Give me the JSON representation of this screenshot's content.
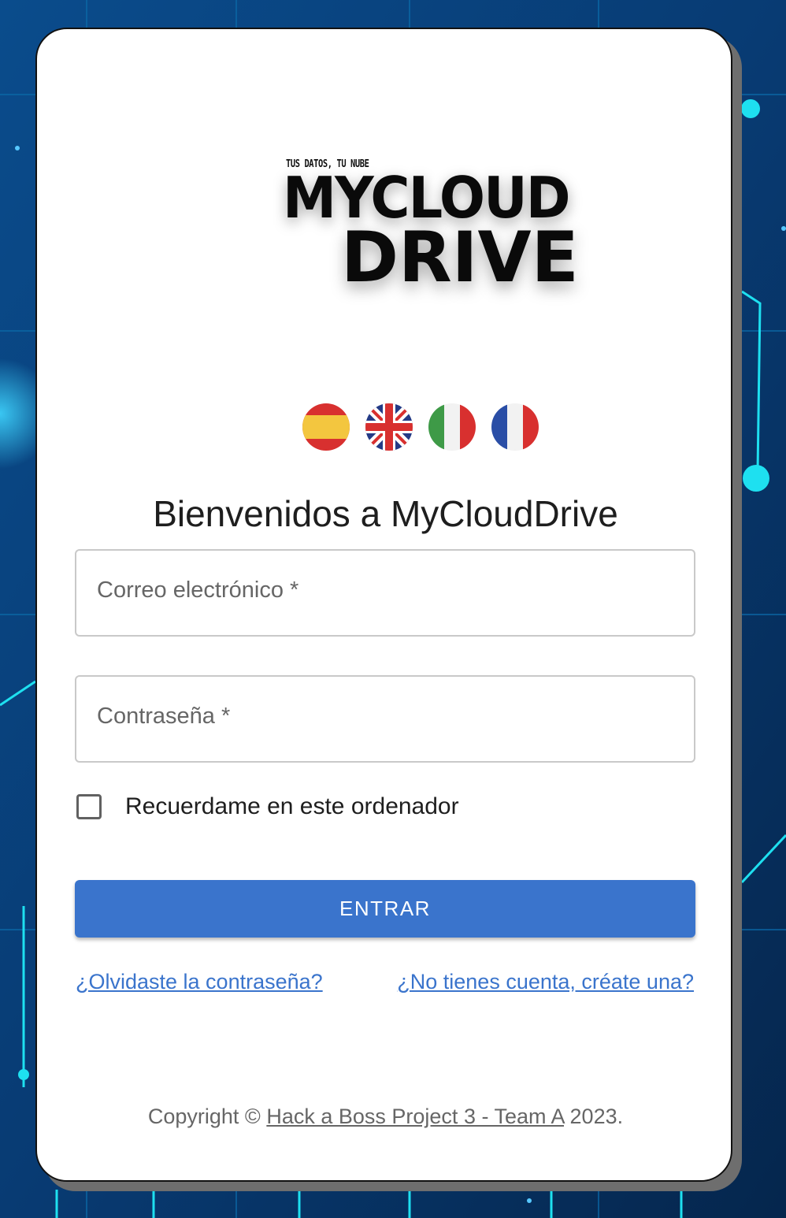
{
  "logo": {
    "tagline": "TUS DATOS, TU NUBE",
    "line1": "MYCLOUD",
    "line2": "DRIVE"
  },
  "languages": [
    {
      "code": "es",
      "icon": "spain-flag-icon"
    },
    {
      "code": "en",
      "icon": "uk-flag-icon"
    },
    {
      "code": "it",
      "icon": "italy-flag-icon"
    },
    {
      "code": "fr",
      "icon": "france-flag-icon"
    }
  ],
  "title": "Bienvenidos a MyCloudDrive",
  "form": {
    "email_label": "Correo electrónico *",
    "password_label": "Contraseña *",
    "remember_label": "Recuerdame en este ordenador",
    "submit_label": "ENTRAR"
  },
  "links": {
    "forgot": "¿Olvidaste la contraseña?",
    "signup": "¿No tienes cuenta, créate una?"
  },
  "footer": {
    "prefix": "Copyright ©",
    "link": "Hack a Boss Project 3 - Team A",
    "suffix": "2023."
  },
  "colors": {
    "primary": "#3a74cc",
    "background": "#08305c",
    "accent": "#1ee0f0"
  }
}
